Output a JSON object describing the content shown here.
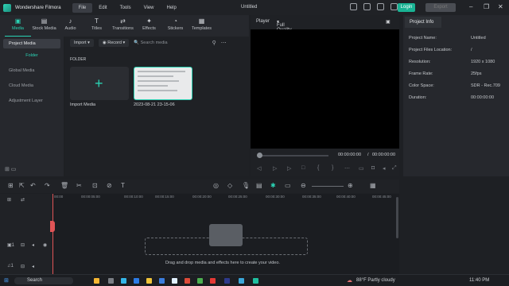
{
  "window": {
    "app_name": "Wondershare Filmora",
    "doc_title": "Untitled",
    "login": "Login",
    "export": "Export"
  },
  "menu": [
    "File",
    "Edit",
    "Tools",
    "View",
    "Help"
  ],
  "tabs": [
    "Media",
    "Stock Media",
    "Audio",
    "Titles",
    "Transitions",
    "Effects",
    "Stickers",
    "Templates"
  ],
  "left_panel": {
    "project_media": "Project Media",
    "folder": "Folder",
    "global_media": "Global Media",
    "cloud_media": "Cloud Media",
    "adjustment_layer": "Adjustment Layer"
  },
  "media": {
    "import": "Import",
    "record": "Record",
    "search_placeholder": "Search media",
    "folder_label": "FOLDER",
    "import_media": "Import Media",
    "clip_name": "2023-08-21 23-15-06"
  },
  "player": {
    "label": "Player",
    "quality": "Full Quality",
    "current": "00:00:00:00",
    "sep": "/",
    "total": "00:00:00:00"
  },
  "info": {
    "tab": "Project Info",
    "rows": [
      {
        "k": "Project Name:",
        "v": "Untitled"
      },
      {
        "k": "Project Files Location:",
        "v": "/"
      },
      {
        "k": "Resolution:",
        "v": "1920 x 1080"
      },
      {
        "k": "Frame Rate:",
        "v": "25fps"
      },
      {
        "k": "Color Space:",
        "v": "SDR - Rec.709"
      },
      {
        "k": "Duration:",
        "v": "00:00:00:00"
      }
    ]
  },
  "ruler": [
    "00:00",
    "00:00:05:00",
    "00:00:10:00",
    "00:00:15:00",
    "00:00:20:00",
    "00:00:25:00",
    "00:00:30:00",
    "00:00:35:00",
    "00:00:40:00",
    "00:00:45:00"
  ],
  "drop_text": "Drag and drop media and effects here to create your video.",
  "taskbar": {
    "search": "Search",
    "weather": "88°F  Partly cloudy",
    "time": "11:40 PM"
  },
  "colors": {
    "accent": "#2ad3b4",
    "playhead": "#e05456"
  }
}
